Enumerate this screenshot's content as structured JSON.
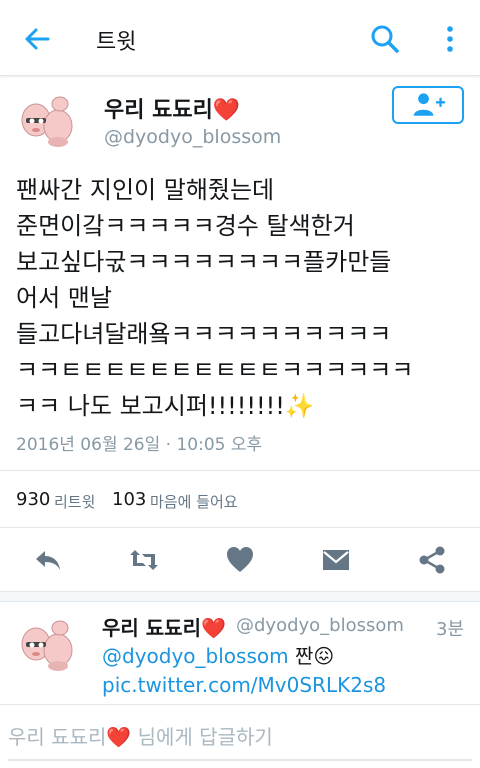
{
  "colors": {
    "accent": "#1da1f2",
    "link": "#1b95e0",
    "heart": "#e0245e",
    "muted": "#8899a6",
    "icon": "#657786"
  },
  "topbar": {
    "title": "트윗",
    "back_icon": "arrow-left-icon",
    "search_icon": "search-icon",
    "more_icon": "more-vertical-icon"
  },
  "tweet": {
    "display_name": "우리 됴됴리❤️",
    "handle": "@dyodyo_blossom",
    "follow_icon": "add-user-icon",
    "text": "팬싸간 지인이 말해줬는데\n준면이갘ㅋㅋㅋㅋㅋ경수 탈색한거\n보고싶다굯ㅋㅋㅋㅋㅋㅋㅋㅋ플카만들\n어서 맨날\n들고다녀달래욬ㅋㅋㅋㅋㅋㅋㅋㅋㅋㅋ\nㅋㅋㅌㅌㅌㅌㅌㅌㅌㅌㅌㅌㅋㅋㅋㅋㅋㅋ\nㅋㅋ 나도 보고시퍼!!!!!!!!✨",
    "timestamp": "2016년 06월 26일 · 10:05 오후",
    "retweet_count": "930",
    "retweet_label": "리트윗",
    "like_count": "103",
    "like_label": "마음에 들어요"
  },
  "actions": [
    {
      "name": "reply-icon"
    },
    {
      "name": "retweet-icon"
    },
    {
      "name": "heart-icon"
    },
    {
      "name": "mail-icon"
    },
    {
      "name": "share-icon"
    }
  ],
  "reply": {
    "display_name": "우리 됴됴리❤️",
    "handle": "@dyodyo_blossom",
    "time": "3분",
    "mention": "@dyodyo_blossom",
    "text_suffix": " 짠😖",
    "link": "pic.twitter.com/Mv0SRLK2s8"
  },
  "composer": {
    "placeholder": "우리 됴됴리❤️ 님에게 답글하기"
  }
}
